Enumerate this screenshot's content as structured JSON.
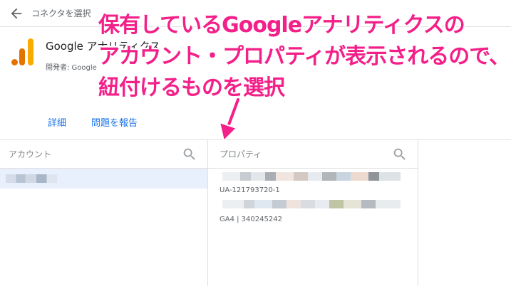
{
  "header": {
    "back_label": "コネクタを選択"
  },
  "connector": {
    "name": "Google アナリティクス",
    "developer": "開発者: Google"
  },
  "links": {
    "details": "詳細",
    "report": "問題を報告"
  },
  "account_panel": {
    "title": "アカウント"
  },
  "property_panel": {
    "title": "プロパティ",
    "properties": [
      {
        "id": "UA-121793720-1"
      },
      {
        "id": "GA4 | 340245242"
      }
    ]
  },
  "annotation": {
    "lines": [
      "保有しているGoogleアナリティクスの",
      "アカウント・プロパティが表示されるので、",
      "紐付けるものを選択"
    ],
    "color": "#f3208a"
  },
  "colors": {
    "accent": "#1a73e8",
    "selected_row": "#e8f0fe",
    "logo_orange": "#f9ab00",
    "logo_dark": "#e37400"
  }
}
